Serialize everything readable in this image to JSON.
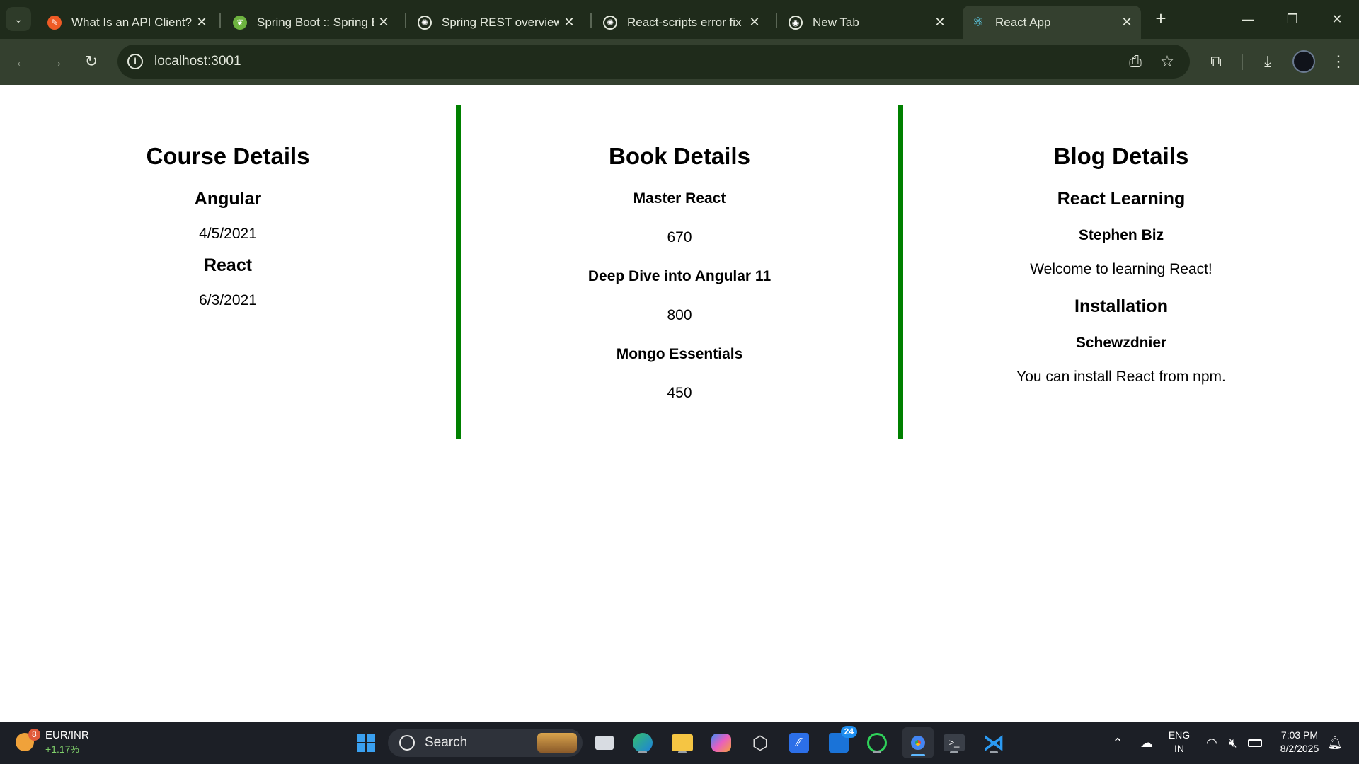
{
  "browser": {
    "tabs": [
      {
        "title": "What Is an API Client?",
        "icon": "postman-icon",
        "color": "#ef5b25"
      },
      {
        "title": "Spring Boot :: Spring B",
        "icon": "spring-icon",
        "color": "#6db33f"
      },
      {
        "title": "Spring REST overview",
        "icon": "chatgpt-icon",
        "color": "#e3e8dc"
      },
      {
        "title": "React-scripts error fix",
        "icon": "chatgpt-icon",
        "color": "#e3e8dc"
      },
      {
        "title": "New Tab",
        "icon": "chrome-icon",
        "color": "#e3e8dc"
      },
      {
        "title": "React App",
        "icon": "react-icon",
        "color": "#61dafb",
        "active": true
      }
    ],
    "url": "localhost:3001"
  },
  "page": {
    "course": {
      "heading": "Course Details",
      "items": [
        {
          "name": "Angular",
          "date": "4/5/2021"
        },
        {
          "name": "React",
          "date": "6/3/2021"
        }
      ]
    },
    "book": {
      "heading": "Book Details",
      "items": [
        {
          "title": "Master React",
          "price": "670"
        },
        {
          "title": "Deep Dive into Angular 11",
          "price": "800"
        },
        {
          "title": "Mongo Essentials",
          "price": "450"
        }
      ]
    },
    "blog": {
      "heading": "Blog Details",
      "items": [
        {
          "title": "React Learning",
          "author": "Stephen Biz",
          "content": "Welcome to learning React!"
        },
        {
          "title": "Installation",
          "author": "Schewzdnier",
          "content": "You can install React from npm."
        }
      ]
    },
    "divider_color": "#008000"
  },
  "taskbar": {
    "widget": {
      "badge": "8",
      "pair": "EUR/INR",
      "change": "+1.17%"
    },
    "search_label": "Search",
    "outlook_badge": "24",
    "lang": {
      "line1": "ENG",
      "line2": "IN"
    },
    "clock": {
      "time": "7:03 PM",
      "date": "8/2/2025"
    }
  }
}
